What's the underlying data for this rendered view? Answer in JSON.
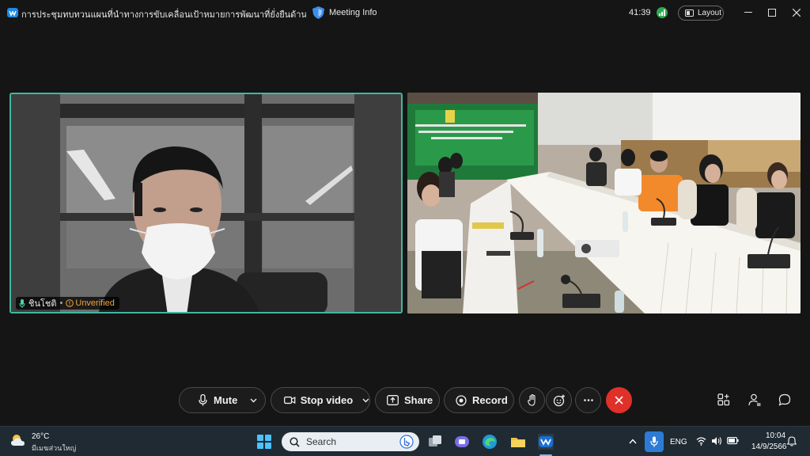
{
  "window": {
    "title": "การประชุมทบทวนแผนที่นำทางการขับเคลื่อนเป้าหมายการพัฒนาที่ยั่งยืนด้านการศึกษาฯ",
    "meeting_info": "Meeting Info",
    "timer": "41:39",
    "layout_label": "Layout"
  },
  "participants": [
    {
      "name": "ชินโชติ",
      "status": "Unverified"
    }
  ],
  "controls": {
    "mute": "Mute",
    "stop_video": "Stop video",
    "share": "Share",
    "record": "Record"
  },
  "taskbar": {
    "temperature": "26°C",
    "weather_desc": "มีเมฆส่วนใหญ่",
    "search_placeholder": "Search",
    "language": "ENG",
    "time": "10:04",
    "date": "14/9/2566"
  },
  "colors": {
    "active_speaker_border": "#3fb8a0",
    "end_call": "#e0302a",
    "unverified": "#f2a33a",
    "taskbar_bg": "#1f2a33"
  },
  "icons": [
    "webex-logo",
    "shield-icon",
    "signal-icon",
    "layout-icon",
    "minimize-icon",
    "maximize-icon",
    "close-icon",
    "mic-icon",
    "camera-icon",
    "share-icon",
    "record-icon",
    "raise-hand-icon",
    "reaction-icon",
    "more-icon",
    "end-call-icon",
    "apps-icon",
    "participants-icon",
    "chat-icon"
  ]
}
